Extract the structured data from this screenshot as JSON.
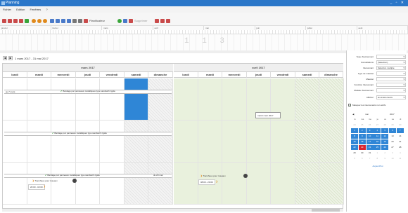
{
  "window": {
    "title": "Planning",
    "controls": "_ ▫ ✕"
  },
  "menu": {
    "items": [
      "Fichier",
      "Edition",
      "Fenêtres",
      "?"
    ]
  },
  "toolbar": {
    "planificateur_label": "Planificateur",
    "supprimer_label": "Supprimer"
  },
  "timeline": {
    "months": [
      "janvier",
      "février",
      "mars",
      "avril",
      "mai",
      "juin",
      "juillet",
      "août"
    ],
    "big_digits": "1 1 3"
  },
  "nav": {
    "prev": "◀",
    "next": "▶",
    "range": "1 mars 2017 - 31 mai 2017"
  },
  "calendar": {
    "month_left": "mars 2017",
    "month_right": "avril 2017",
    "weekdays": [
      "lundi",
      "mardi",
      "mercredi",
      "jeudi",
      "vendredi",
      "samedi",
      "dimanche"
    ],
    "events": {
      "row1_left": "au 7 mars",
      "row1_main": "Bardage par panneaux métalliques type sandwich rigide",
      "row2_main": "Bardage par panneaux métalliques type sandwich rigide",
      "row3_main": "Bardage par panneaux métalliques type sandwich rigide",
      "row3_right": "du 29 mar.",
      "task_left": "Tranchées pour réseaux",
      "task_left_time": "20:00 - 02:00",
      "task_right": "Tranchées pour réseaux",
      "task_right_time": "08:00 - 20:00",
      "tooltip": "mardi 4 avr 2017"
    }
  },
  "panel": {
    "filters": [
      {
        "label": "Type d'événement",
        "value": ""
      },
      {
        "label": "Consultations",
        "value": "(Sélection)"
      },
      {
        "label": "Intervenant",
        "value": "Sélection multiple"
      },
      {
        "label": "Type de matériel",
        "value": ""
      },
      {
        "label": "Matériel",
        "value": ""
      },
      {
        "label": "Fonction Intervenant",
        "value": ""
      },
      {
        "label": "Modèle d'événement",
        "value": ""
      },
      {
        "label": "Afficher",
        "value": "les événements"
      }
    ],
    "checkbox_label": "Masquer les intervenants non actifs",
    "minical": {
      "prev": "◀",
      "month": "mai",
      "year": "2017",
      "days": [
        "lu",
        "ma",
        "me",
        "je",
        "ve",
        "sa",
        "di"
      ],
      "today": "Aujourd'hui",
      "rows": [
        [
          "24",
          "25",
          "26",
          "27",
          "28",
          "29",
          "30"
        ],
        [
          "1",
          "2",
          "3",
          "4",
          "5",
          "6",
          "7"
        ],
        [
          "8",
          "9",
          "10",
          "11",
          "12",
          "13",
          "14"
        ],
        [
          "15",
          "16",
          "17",
          "18",
          "19",
          "20",
          "21"
        ],
        [
          "22",
          "23",
          "24",
          "25",
          "26",
          "27",
          "28"
        ],
        [
          "29",
          "30",
          "31",
          "1",
          "2",
          "3",
          "4"
        ],
        [
          "5",
          "6",
          "7",
          "8",
          "9",
          "10",
          "11"
        ]
      ]
    }
  },
  "colors": {
    "accent": "#2b77c9",
    "selection": "#2f86d6",
    "today": "#d9262f",
    "check": "#3a9a3a"
  }
}
